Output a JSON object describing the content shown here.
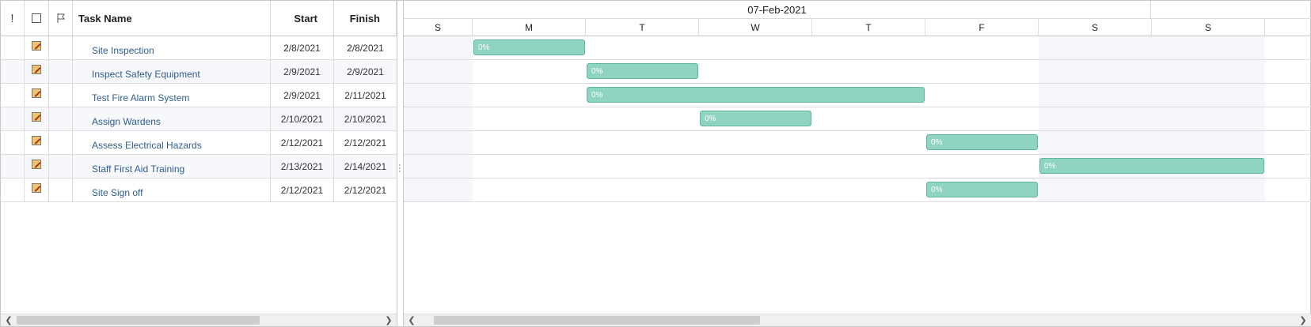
{
  "grid": {
    "columns": {
      "importance": "!",
      "name": "Task Name",
      "start": "Start",
      "finish": "Finish"
    },
    "rows": [
      {
        "name": "Site Inspection",
        "start": "2/8/2021",
        "finish": "2/8/2021"
      },
      {
        "name": "Inspect Safety Equipment",
        "start": "2/9/2021",
        "finish": "2/9/2021"
      },
      {
        "name": "Test Fire Alarm System",
        "start": "2/9/2021",
        "finish": "2/11/2021"
      },
      {
        "name": "Assign Wardens",
        "start": "2/10/2021",
        "finish": "2/10/2021"
      },
      {
        "name": "Assess Electrical Hazards",
        "start": "2/12/2021",
        "finish": "2/12/2021"
      },
      {
        "name": "Staff First Aid Training",
        "start": "2/13/2021",
        "finish": "2/14/2021"
      },
      {
        "name": "Site Sign off",
        "start": "2/12/2021",
        "finish": "2/12/2021"
      }
    ]
  },
  "chart": {
    "week_label": "07-Feb-2021",
    "days": [
      "S",
      "M",
      "T",
      "W",
      "T",
      "F",
      "S",
      "S"
    ],
    "bars": [
      {
        "label": "0%"
      },
      {
        "label": "0%"
      },
      {
        "label": "0%"
      },
      {
        "label": "0%"
      },
      {
        "label": "0%"
      },
      {
        "label": "0%"
      },
      {
        "label": "0%"
      }
    ],
    "bar_color": "#8fd3c1"
  }
}
